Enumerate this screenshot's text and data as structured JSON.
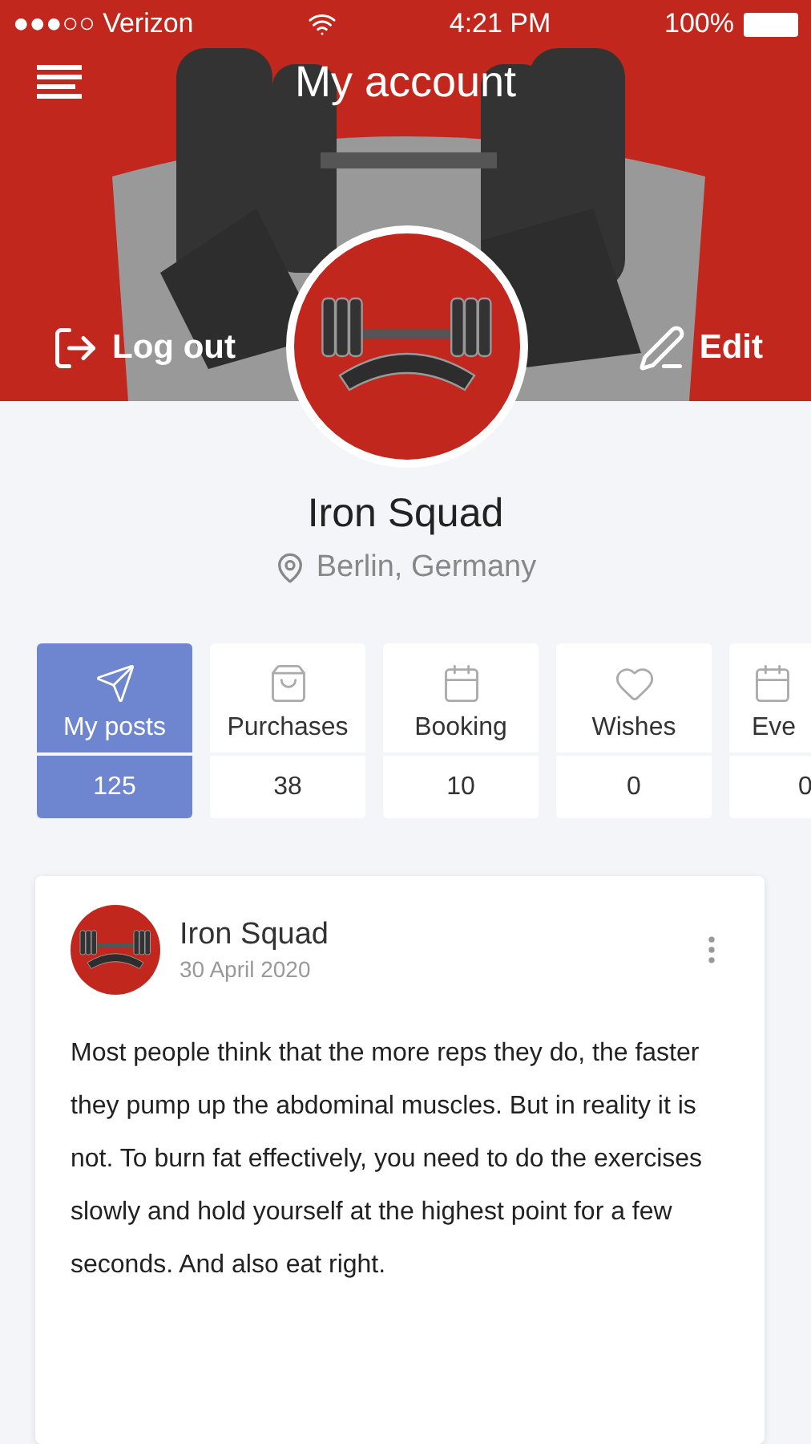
{
  "status_bar": {
    "carrier": "●●●○○ Verizon",
    "time": "4:21 PM",
    "battery": "100%"
  },
  "header": {
    "title": "My account",
    "logout": "Log out",
    "edit": "Edit"
  },
  "profile": {
    "name": "Iron Squad",
    "location": "Berlin, Germany"
  },
  "tabs": [
    {
      "label": "My posts",
      "count": "125",
      "selected": true
    },
    {
      "label": "Purchases",
      "count": "38",
      "selected": false
    },
    {
      "label": "Booking",
      "count": "10",
      "selected": false
    },
    {
      "label": "Wishes",
      "count": "0",
      "selected": false
    },
    {
      "label": "Eve",
      "count": "0",
      "selected": false
    }
  ],
  "post": {
    "author": "Iron Squad",
    "date": "30 April 2020",
    "text": "Most people think that the more reps they do, the faster they pump up the abdominal muscles. But in reality it is not. To burn fat effectively, you need to do the exercises slowly and hold yourself at the highest point for a few seconds. And also eat right."
  }
}
